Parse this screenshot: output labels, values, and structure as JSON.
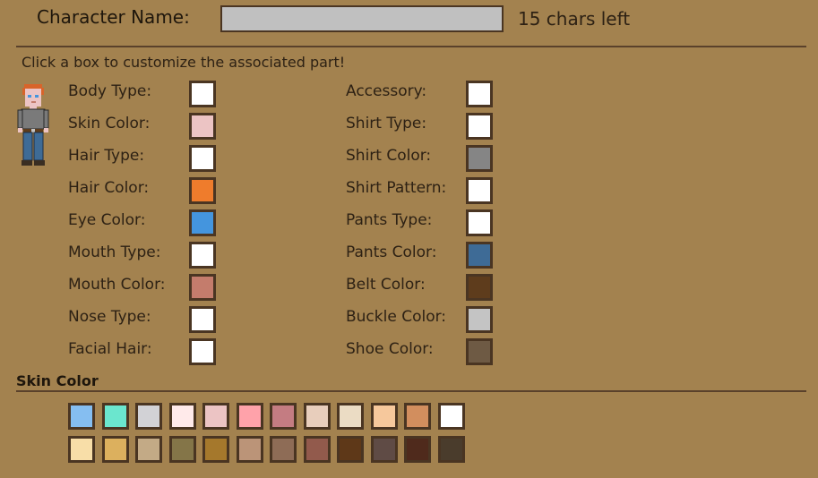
{
  "header": {
    "name_label": "Character Name:",
    "name_value": "",
    "chars_left": "15 chars left"
  },
  "hint": "Click a box to customize the associated part!",
  "options_left": [
    {
      "label": "Body Type:",
      "color": "#ffffff"
    },
    {
      "label": "Skin Color:",
      "color": "#ecc4c4"
    },
    {
      "label": "Hair Type:",
      "color": "#ffffff"
    },
    {
      "label": "Hair Color:",
      "color": "#ef7c2c"
    },
    {
      "label": "Eye Color:",
      "color": "#4495de"
    },
    {
      "label": "Mouth Type:",
      "color": "#ffffff"
    },
    {
      "label": "Mouth Color:",
      "color": "#c47c6c"
    },
    {
      "label": "Nose Type:",
      "color": "#ffffff"
    },
    {
      "label": "Facial Hair:",
      "color": "#ffffff"
    }
  ],
  "options_right": [
    {
      "label": "Accessory:",
      "color": "#ffffff"
    },
    {
      "label": "Shirt Type:",
      "color": "#ffffff"
    },
    {
      "label": "Shirt Color:",
      "color": "#858585"
    },
    {
      "label": "Shirt Pattern:",
      "color": "#ffffff"
    },
    {
      "label": "Pants Type:",
      "color": "#ffffff"
    },
    {
      "label": "Pants Color:",
      "color": "#3e6b96"
    },
    {
      "label": "Belt Color:",
      "color": "#5e3c1c"
    },
    {
      "label": "Buckle Color:",
      "color": "#c4c4c4"
    },
    {
      "label": "Shoe Color:",
      "color": "#6e5a44"
    }
  ],
  "palette": {
    "title": "Skin Color",
    "row1": [
      "#85bef1",
      "#6be6ce",
      "#d2d2d6",
      "#ffeaea",
      "#ecc4c4",
      "#ffa2aa",
      "#c47c82",
      "#e8cebc",
      "#ebdcc4",
      "#f6c89c",
      "#d28e5e",
      "#ffffff"
    ],
    "row2": [
      "#f8dea8",
      "#dcb05e",
      "#c3aa86",
      "#847548",
      "#a5782c",
      "#bb9478",
      "#8e6c56",
      "#925a4c",
      "#5e3818",
      "#5f4b45",
      "#4f2a1c",
      "#4a3c2c"
    ]
  }
}
